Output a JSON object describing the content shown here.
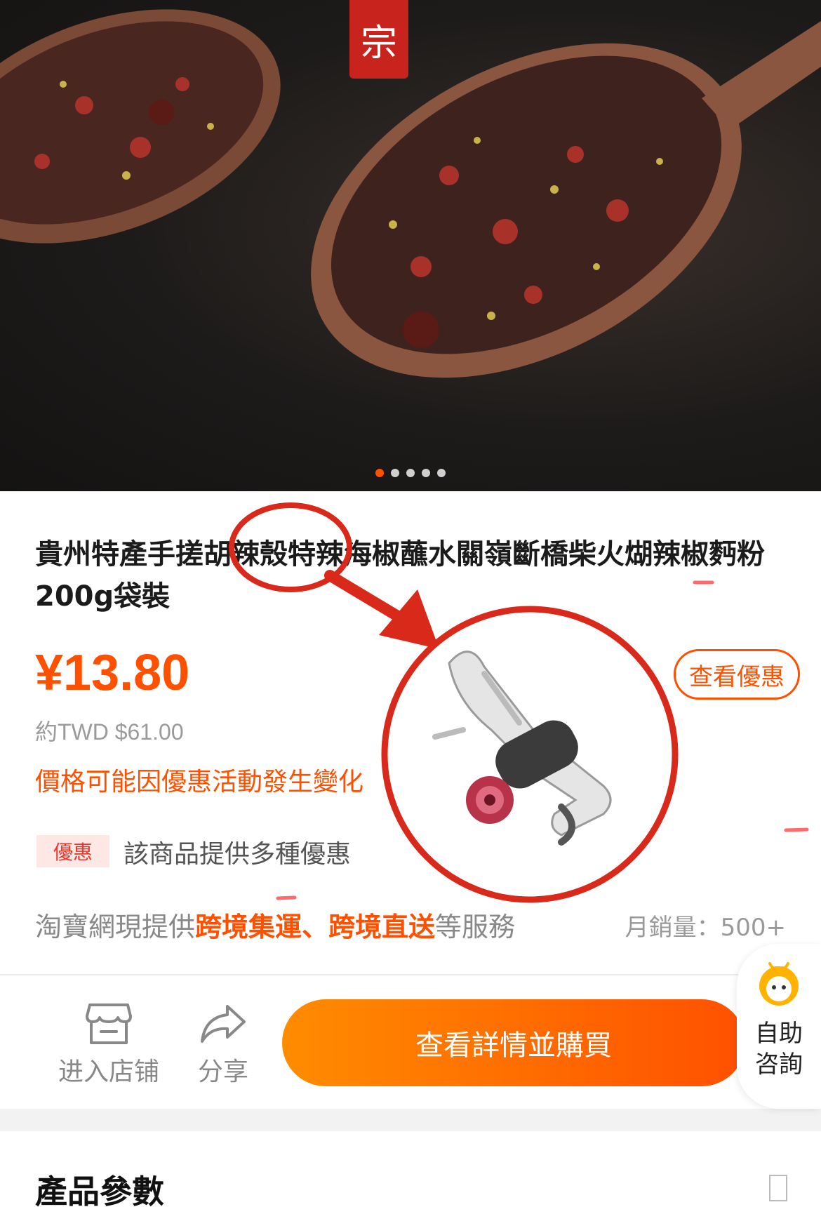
{
  "hero": {
    "seal_text": "宗",
    "slide_count": 5,
    "active_slide": 1
  },
  "product": {
    "title": "貴州特產手搓胡辣殼特辣海椒蘸水關嶺斷橋柴火煳辣椒麪粉200g袋裝",
    "price": "¥13.80",
    "twd_price": "約TWD $61.00",
    "price_notice": "價格可能因優惠活動發生變化",
    "deal_button": "查看優惠",
    "promo_badge": "優惠",
    "promo_text": "該商品提供多種優惠",
    "service_prefix": "淘寶網現提供",
    "service_highlight": "跨境集運、跨境直送",
    "service_suffix": "等服務",
    "monthly_sales": "月銷量：500+"
  },
  "actions": {
    "store_label": "进入店铺",
    "share_label": "分享",
    "buy_label": "查看詳情並購買",
    "helper_label_1": "自助",
    "helper_label_2": "咨詢"
  },
  "params": {
    "title": "產品參數"
  },
  "colors": {
    "accent": "#ff5000",
    "annotation": "#d9291b"
  },
  "icons": {
    "store": "store-icon",
    "share": "share-icon",
    "helper": "helper-mascot-icon"
  }
}
